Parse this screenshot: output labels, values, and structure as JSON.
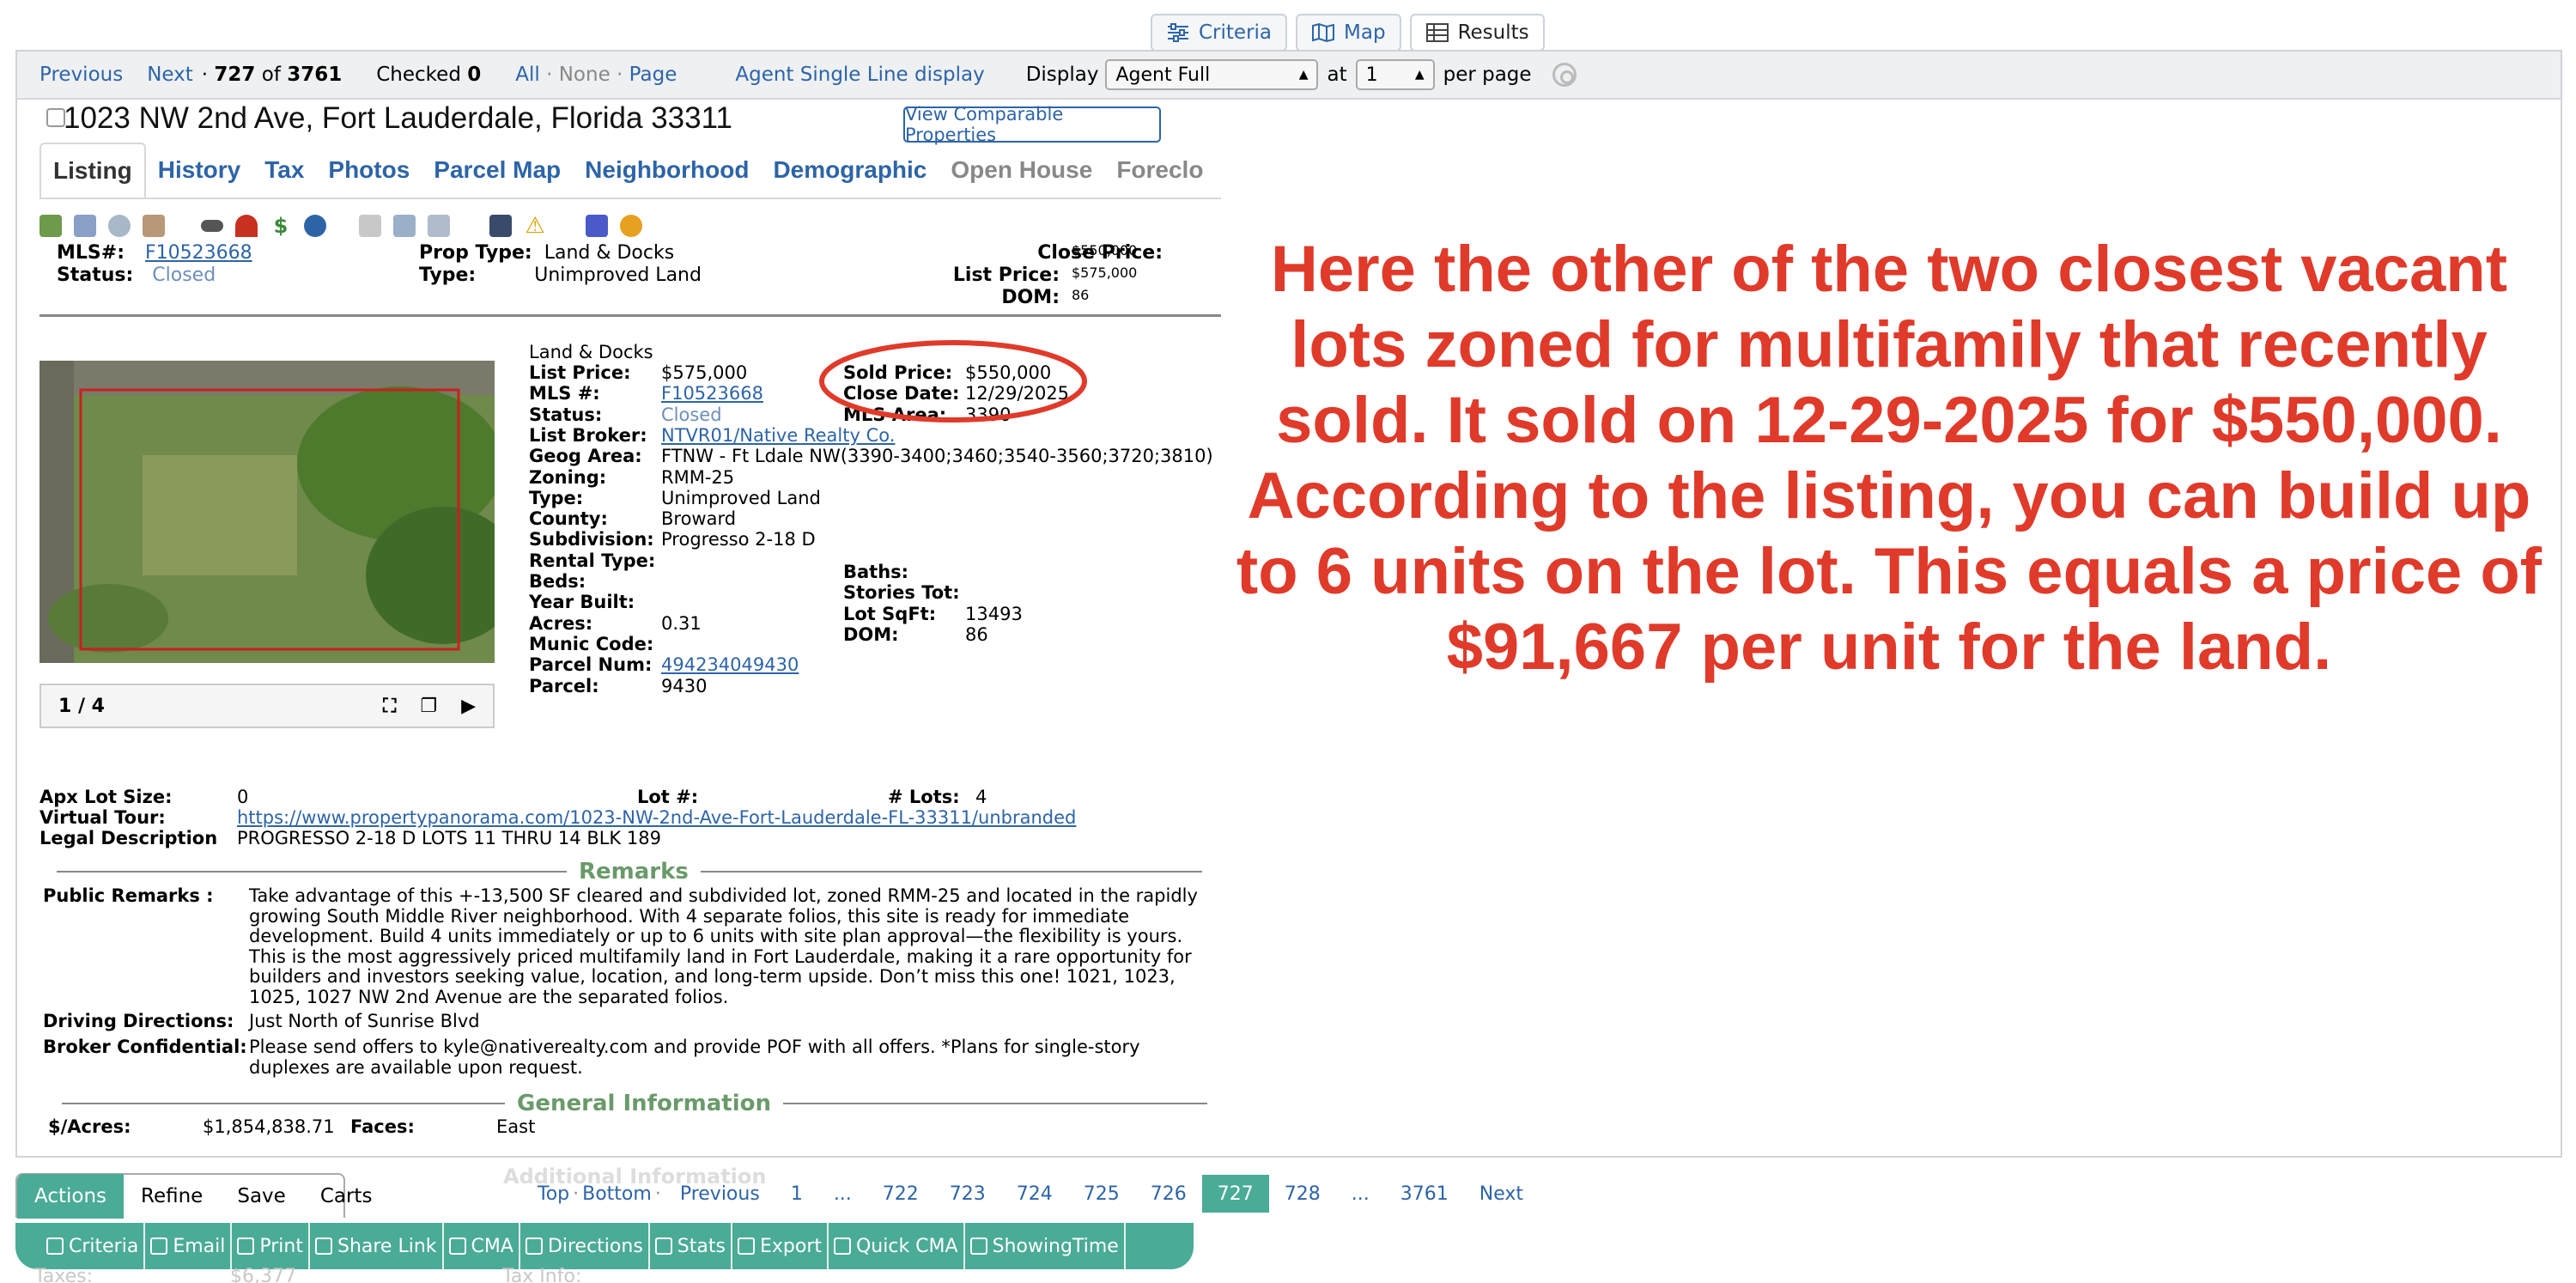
{
  "view_tabs": [
    {
      "label": "Criteria",
      "icon": "sliders-icon"
    },
    {
      "label": "Map",
      "icon": "map-icon"
    },
    {
      "label": "Results",
      "icon": "table-icon"
    }
  ],
  "nav": {
    "previous": "Previous",
    "next": "Next",
    "position": "727",
    "of": "of",
    "total": "3761",
    "checked_label": "Checked",
    "checked_count": "0",
    "all": "All",
    "none": "None",
    "page": "Page",
    "agent_single": "Agent Single Line display",
    "display_label": "Display",
    "display_value": "Agent Full",
    "at_label": "at",
    "at_value": "1",
    "per_page": "per page"
  },
  "listing": {
    "address": "1023 NW 2nd Ave, Fort Lauderdale, Florida 33311",
    "comparable_button": "View Comparable Properties",
    "tabs": [
      "Listing",
      "History",
      "Tax",
      "Photos",
      "Parcel Map",
      "Neighborhood",
      "Demographic",
      "Open House",
      "Foreclo"
    ],
    "summary": {
      "mls_label": "MLS#:",
      "mls": "F10523668",
      "status_label": "Status:",
      "status": "Closed",
      "prop_type_label": "Prop Type:",
      "prop_type": "Land & Docks",
      "type_label": "Type:",
      "type": "Unimproved Land",
      "close_price_label": "Close Price:",
      "close_price": "$550,000",
      "list_price_label": "List Price:",
      "list_price": "$575,000",
      "dom_label": "DOM:",
      "dom": "86"
    },
    "carousel": {
      "counter": "1 / 4"
    },
    "details_heading": "Land & Docks",
    "details_left": [
      [
        "List Price:",
        "$575,000"
      ],
      [
        "MLS #:",
        "F10523668"
      ],
      [
        "Status:",
        "Closed"
      ],
      [
        "List Broker:",
        "NTVR01/Native Realty Co."
      ],
      [
        "Geog Area:",
        "FTNW - Ft Ldale NW(3390-3400;3460;3540-3560;3720;3810)"
      ],
      [
        "Zoning:",
        "RMM-25"
      ],
      [
        "Type:",
        "Unimproved Land"
      ],
      [
        "County:",
        "Broward"
      ],
      [
        "Subdivision:",
        "Progresso 2-18 D"
      ],
      [
        "Rental Type:",
        ""
      ],
      [
        "Beds:",
        ""
      ],
      [
        "Year Built:",
        ""
      ],
      [
        "Acres:",
        "0.31"
      ],
      [
        "Munic Code:",
        ""
      ],
      [
        "Parcel Num:",
        "494234049430"
      ],
      [
        "Parcel:",
        "9430"
      ]
    ],
    "details_right": [
      [
        "Sold Price:",
        "$550,000"
      ],
      [
        "Close Date:",
        "12/29/2025"
      ],
      [
        "MLS Area:",
        "3390"
      ]
    ],
    "details_right2": [
      [
        "Baths:",
        ""
      ],
      [
        "Stories Tot:",
        ""
      ],
      [
        "Lot SqFt:",
        "13493"
      ],
      [
        "DOM:",
        "86"
      ]
    ],
    "lot": {
      "apx_label": "Apx Lot Size:",
      "apx": "0",
      "lotnum_label": "Lot #:",
      "lotnum": "",
      "lots_label": "# Lots:",
      "lots": "4",
      "tour_label": "Virtual Tour:",
      "tour": "https://www.propertypanorama.com/1023-NW-2nd-Ave-Fort-Lauderdale-FL-33311/unbranded",
      "legal_label": "Legal Description",
      "legal": "PROGRESSO 2-18 D LOTS 11 THRU 14 BLK 189"
    },
    "remarks_title": "Remarks",
    "public_label": "Public Remarks :",
    "public": "Take advantage of this +-13,500 SF cleared and subdivided lot, zoned RMM-25 and located in the rapidly growing South Middle River neighborhood. With 4 separate folios, this site is ready for immediate development. Build 4 units immediately or up to 6 units with site plan approval—the flexibility is yours. This is the most aggressively priced multifamily land in Fort Lauderdale, making it a rare opportunity for builders and investors seeking value, location, and long-term upside. Don’t miss this one! 1021, 1023, 1025, 1027 NW 2nd Avenue are the separated folios.",
    "driving_label": "Driving Directions:",
    "driving": "Just North of Sunrise Blvd",
    "broker_label": "Broker Confidential:",
    "broker": "Please send offers to kyle@nativerealty.com and provide POF with all offers. *Plans for single-story duplexes are available upon request.",
    "general_title": "General Information",
    "per_acre_label": "$/Acres:",
    "per_acre": "$1,854,838.71",
    "faces_label": "Faces:",
    "faces": "East",
    "hidden_section": "Additional Information",
    "bleed_left": "Taxes:",
    "bleed_val": "$6,377",
    "bleed_right": "Tax Info:"
  },
  "annotation": {
    "text": "Here the other of the two closest vacant lots zoned for multifamily that recently sold. It sold on 12-29-2025 for $550,000. According to the listing, you can build up to 6 units on the lot. This equals a price of $91,667 per unit for the land.",
    "color": "#e03a2a"
  },
  "pager": {
    "top": "Top",
    "bottom": "Bottom",
    "previous": "Previous",
    "pages": [
      "1",
      "...",
      "722",
      "723",
      "724",
      "725",
      "726",
      "727",
      "728",
      "...",
      "3761"
    ],
    "current": "727",
    "next": "Next"
  },
  "action_tabs": [
    "Actions",
    "Refine",
    "Save",
    "Carts"
  ],
  "toolbar": [
    {
      "label": "Criteria",
      "icon": "search-icon"
    },
    {
      "label": "Email",
      "icon": "email-icon"
    },
    {
      "label": "Print",
      "icon": "print-icon"
    },
    {
      "label": "Share Link",
      "icon": "link-icon"
    },
    {
      "label": "CMA",
      "icon": "cma-icon"
    },
    {
      "label": "Directions",
      "icon": "directions-icon"
    },
    {
      "label": "Stats",
      "icon": "stats-icon"
    },
    {
      "label": "Export",
      "icon": "export-icon"
    },
    {
      "label": "Quick CMA",
      "icon": "quick-cma-icon"
    },
    {
      "label": "ShowingTime",
      "icon": "showingtime-icon"
    }
  ],
  "colors": {
    "link": "#2d64a8",
    "accent": "#4aab96",
    "annotation": "#e03a2a",
    "section_title": "#6a9a6a"
  }
}
